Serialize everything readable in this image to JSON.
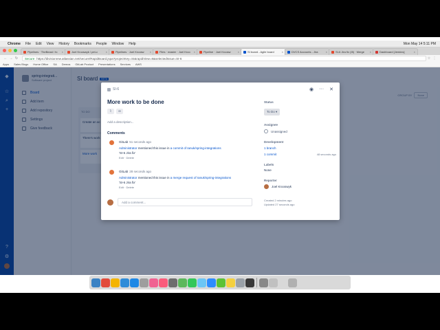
{
  "menubar": {
    "items": [
      "Chrome",
      "File",
      "Edit",
      "View",
      "History",
      "Bookmarks",
      "People",
      "Window",
      "Help"
    ],
    "clock": "Mon May 14  5:11 PM"
  },
  "tabs": [
    {
      "label": "Pipelines · TheBeast / fo",
      "active": false
    },
    {
      "label": "Joel Krooswyk / pet-c",
      "active": false
    },
    {
      "label": "Pipelines · Joel Kroosw",
      "active": false
    },
    {
      "label": "Files · master · Joel Kroo",
      "active": false
    },
    {
      "label": "Pipeline · Joel Kroosw",
      "active": false
    },
    {
      "label": "SI board - Agile board",
      "active": true
    },
    {
      "label": "DVCS Accounts - Jira",
      "active": false
    },
    {
      "label": "SI-6 Jira fix (!8) · Merge",
      "active": false
    },
    {
      "label": "Dashboard [Jenkins]",
      "active": false
    }
  ],
  "address": {
    "secure_label": "Secure",
    "url": "https://divisionrew.atlassian.net/secure/RapidBoard.jspa?projectKey=SI&rapidView=8&selectedIssue=SI-6"
  },
  "bookmarks": [
    "Apps",
    "Sales Blogs",
    "Home Office",
    "SA",
    "Demos",
    "GitLab Product",
    "Presentations",
    "Services",
    "AWS"
  ],
  "sidebar": {
    "project_name": "spring-integrati...",
    "project_sub": "Software project",
    "items": [
      "Board",
      "Add item",
      "Add repository",
      "Settings",
      "Give feedback"
    ]
  },
  "board": {
    "title": "SI board",
    "badge": "BETA",
    "group_by_label": "GROUP BY",
    "group_by_value": "None",
    "column_title": "TO DO",
    "cards": [
      "Create an ac",
      "There's work",
      "More work"
    ]
  },
  "modal": {
    "issue_key": "SI-6",
    "title": "More work to be done",
    "attach_icon": "paperclip-icon",
    "link_icon": "link-icon",
    "description_placeholder": "Add a description...",
    "comments_heading": "Comments",
    "comments": [
      {
        "author": "GitLab",
        "time": "51 seconds ago",
        "prefix": "Administrator",
        "text": " mentioned this issue in ",
        "link": "a commit of Ianuk/spring-integrations",
        "line2": "'SI-6 Jira fix'",
        "edit": "Edit",
        "delete": "Delete"
      },
      {
        "author": "GitLab",
        "time": "28 seconds ago",
        "prefix": "Administrator",
        "text": " mentioned this issue in ",
        "link": "a merge request of Ianuk/spring-integrations",
        "line2": "'SI-6 Jira fix'",
        "edit": "Edit",
        "delete": "Delete"
      }
    ],
    "add_comment_placeholder": "Add a comment...",
    "status_label": "Status",
    "status_value": "To Do",
    "assignee_label": "Assignee",
    "assignee_value": "Unassigned",
    "development_label": "Development",
    "branch_text": "1 branch",
    "commit_text": "1 commit",
    "commit_time": "48 seconds ago",
    "labels_label": "Labels",
    "labels_value": "None",
    "reporter_label": "Reporter",
    "reporter_value": "Joel Krooswyk",
    "created": "Created 2 minutes ago",
    "updated": "Updated 27 seconds ago"
  },
  "dock": {
    "colors": [
      "#3b82c4",
      "#e24b3b",
      "#f4b400",
      "#2f8cd8",
      "#1e88e5",
      "#9e9e9e",
      "#f06292",
      "#fb5c7c",
      "#6d6d6d",
      "#5cb85c",
      "#34c759",
      "#6cc6f5",
      "#2d8cff",
      "#5bc236",
      "#f4d03f",
      "#9aa1a8",
      "#3a3a3a",
      "#888888",
      "#c0c0c0",
      "#d8d8d8",
      "#b0b0b0"
    ]
  }
}
